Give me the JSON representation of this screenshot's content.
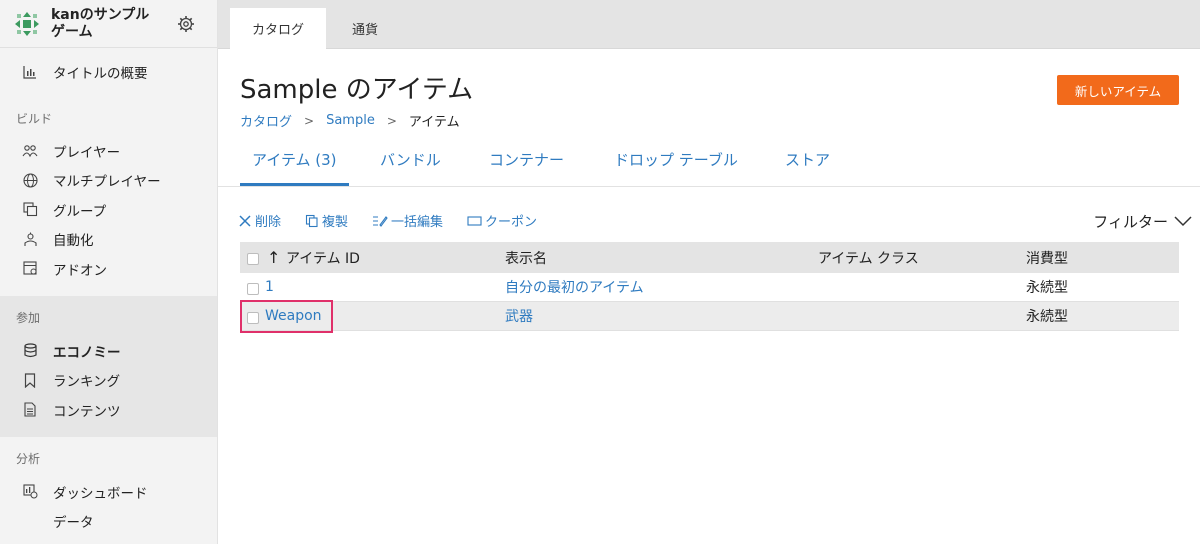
{
  "app": {
    "name": "kanのサンプルゲーム"
  },
  "sidebar": {
    "overview": "タイトルの概要",
    "sections": [
      {
        "heading": "ビルド",
        "items": [
          "プレイヤー",
          "マルチプレイヤー",
          "グループ",
          "自動化",
          "アドオン"
        ]
      },
      {
        "heading": "参加",
        "items": [
          "エコノミー",
          "ランキング",
          "コンテンツ"
        ]
      },
      {
        "heading": "分析",
        "items": [
          "ダッシュボード",
          "データ"
        ]
      }
    ]
  },
  "topTabs": [
    "カタログ",
    "通貨"
  ],
  "page": {
    "title": "Sample のアイテム",
    "newButton": "新しいアイテム",
    "breadcrumb": [
      "カタログ",
      "Sample",
      "アイテム"
    ],
    "subTabs": [
      "アイテム (3)",
      "バンドル",
      "コンテナー",
      "ドロップ テーブル",
      "ストア"
    ]
  },
  "toolbar": {
    "delete": "削除",
    "duplicate": "複製",
    "bulkEdit": "一括編集",
    "coupon": "クーポン",
    "filter": "フィルター"
  },
  "table": {
    "sortArrow": "↑",
    "headers": [
      "アイテム ID",
      "表示名",
      "アイテム クラス",
      "消費型"
    ],
    "rows": [
      {
        "id": "1",
        "name": "自分の最初のアイテム",
        "class": "",
        "consumable": "永続型"
      },
      {
        "id": "Weapon",
        "name": "武器",
        "class": "",
        "consumable": "永続型"
      }
    ]
  },
  "colors": {
    "accent": "#2f7bc0",
    "primaryButton": "#f26a1b",
    "highlight": "#e0306a"
  }
}
